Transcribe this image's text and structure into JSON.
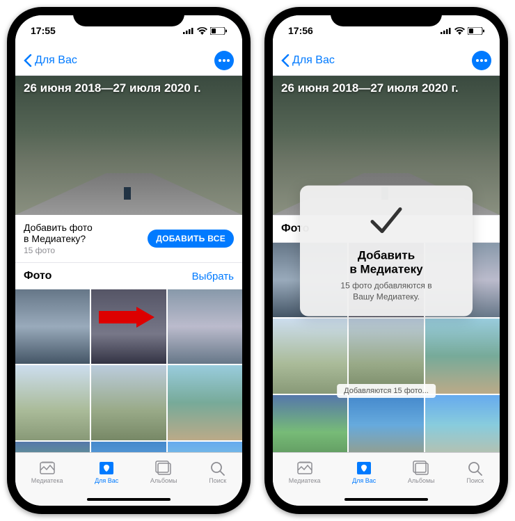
{
  "status": {
    "time_left": "17:55",
    "time_right": "17:56"
  },
  "nav": {
    "back": "Для Вас"
  },
  "hero": {
    "title": "26 июня 2018—27 июля 2020 г."
  },
  "prompt": {
    "line1": "Добавить фото",
    "line2": "в Медиатеку?",
    "sub": "15 фото",
    "button": "ДОБАВИТЬ ВСЕ"
  },
  "section": {
    "title": "Фото",
    "action": "Выбрать"
  },
  "modal": {
    "title1": "Добавить",
    "title2": "в Медиатеку",
    "sub1": "15 фото добавляются в",
    "sub2": "Вашу Медиатеку."
  },
  "toast": "Добавляются 15 фото...",
  "tabs": {
    "library": "Медиатека",
    "foryou": "Для Вас",
    "albums": "Альбомы",
    "search": "Поиск"
  }
}
